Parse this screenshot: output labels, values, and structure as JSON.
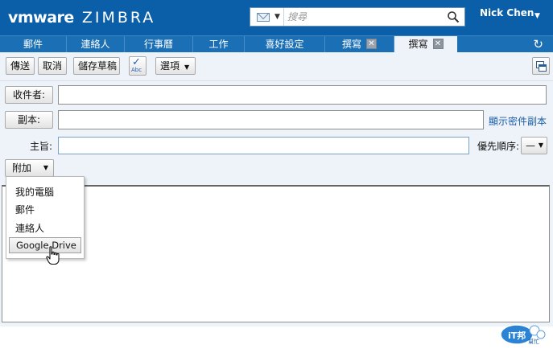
{
  "app": {
    "brand_vm": "vmware",
    "brand_product": "ZIMBRA",
    "colors": {
      "header": "#0a5fa8",
      "tabbar": "#1b6fb5",
      "panel": "#eef3f9",
      "link": "#1a5ea8"
    }
  },
  "search": {
    "type_icon": "envelope-icon",
    "placeholder": "搜尋"
  },
  "user": {
    "name": "Nick Chen"
  },
  "tabs": [
    {
      "label": "郵件",
      "active": false
    },
    {
      "label": "連絡人",
      "active": false
    },
    {
      "label": "行事曆",
      "active": false
    },
    {
      "label": "工作",
      "active": false
    },
    {
      "label": "喜好設定",
      "active": false
    },
    {
      "label": "撰寫",
      "active": false,
      "closable": true
    },
    {
      "label": "撰寫",
      "active": true,
      "closable": true
    }
  ],
  "toolbar": {
    "send": "傳送",
    "cancel": "取消",
    "save_draft": "儲存草稿",
    "spell_icon": "spellcheck-icon",
    "spell_text": "Abc",
    "options": "選項",
    "detach_icon": "detach-window-icon"
  },
  "compose": {
    "to_label": "收件者:",
    "to_value": "",
    "cc_label": "副本:",
    "cc_value": "",
    "show_bcc": "顯示密件副本",
    "subject_label": "主旨:",
    "subject_value": "",
    "priority_label": "優先順序:",
    "priority_value": "—",
    "attach_label": "附加"
  },
  "attach_menu": {
    "items": [
      "我的電腦",
      "郵件",
      "連絡人",
      "Google Drive"
    ],
    "highlighted": "Google Drive"
  },
  "watermark": {
    "text_main": "iT邦",
    "text_sub": "幫忙"
  }
}
